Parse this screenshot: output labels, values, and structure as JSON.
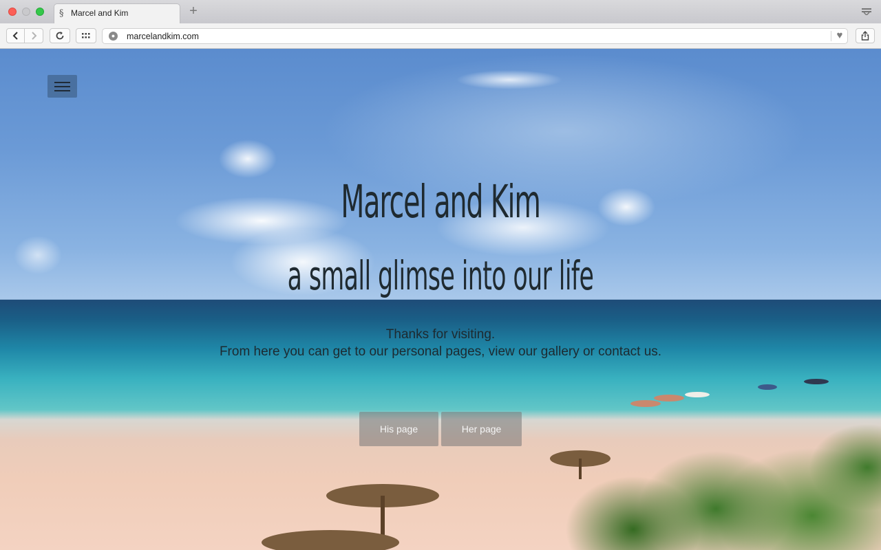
{
  "browser": {
    "tab_title": "Marcel and Kim",
    "tab_favicon": "§",
    "new_tab_symbol": "+",
    "url": "marcelandkim.com"
  },
  "page": {
    "title": "Marcel and Kim",
    "subtitle": "a small glimse into our life",
    "intro_line1": "Thanks for visiting.",
    "intro_line2": "From here you can get to our personal pages, view our gallery or contact us.",
    "buttons": {
      "his": "His page",
      "her": "Her page"
    }
  },
  "icons": {
    "close": "close-icon",
    "minimize": "minimize-icon",
    "maximize": "maximize-icon",
    "back": "chevron-left-icon",
    "forward": "chevron-right-icon",
    "reload": "reload-icon",
    "top_sites": "grid-icon",
    "site_info": "globe-icon",
    "favorite": "heart-icon",
    "share": "share-icon",
    "menu": "hamburger-icon",
    "tab_overview": "tab-overview-icon"
  },
  "colors": {
    "close": "#fc5f57",
    "minimize": "#c9c9cc",
    "maximize": "#34c84a",
    "title_text": "#1f2a30",
    "button_bg": "#787878"
  }
}
